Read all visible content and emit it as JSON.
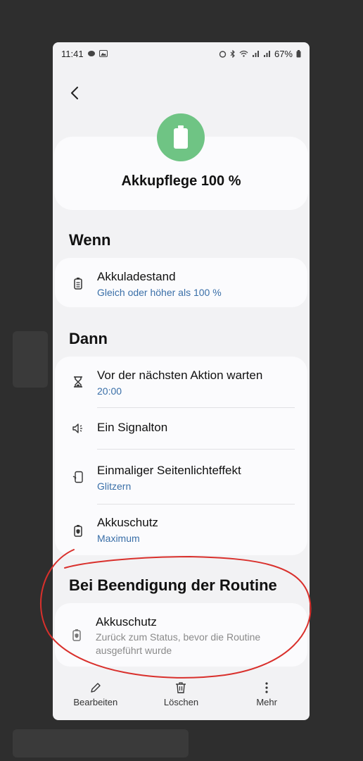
{
  "status_bar": {
    "time": "11:41",
    "battery_percent": "67%",
    "icons": [
      "alarm-icon",
      "bluetooth-icon",
      "wifi-icon",
      "signal-icon",
      "signal-icon",
      "battery-icon"
    ]
  },
  "header": {
    "icon": "battery-icon",
    "title": "Akkupflege 100 %"
  },
  "sections": {
    "if_title": "Wenn",
    "then_title": "Dann",
    "end_title": "Bei Beendigung der Routine"
  },
  "if_items": [
    {
      "icon": "battery-level-icon",
      "title": "Akkuladestand",
      "subtitle": "Gleich oder höher als 100 %"
    }
  ],
  "then_items": [
    {
      "icon": "hourglass-icon",
      "title": "Vor der nächsten Aktion warten",
      "subtitle": "20:00"
    },
    {
      "icon": "speaker-icon",
      "title": "Ein Signalton",
      "subtitle": ""
    },
    {
      "icon": "edge-lighting-icon",
      "title": "Einmaliger Seitenlichteffekt",
      "subtitle": "Glitzern"
    },
    {
      "icon": "battery-protect-icon",
      "title": "Akkuschutz",
      "subtitle": "Maximum"
    }
  ],
  "end_items": [
    {
      "icon": "battery-protect-icon",
      "title": "Akkuschutz",
      "subtitle": "Zurück zum Status, bevor die Routine ausgeführt wurde"
    }
  ],
  "bottom_bar": {
    "edit": "Bearbeiten",
    "delete": "Löschen",
    "more": "Mehr"
  },
  "colors": {
    "accent_green": "#6fc484",
    "link_blue": "#3a6fa8",
    "annotation_red": "#d9302c"
  }
}
